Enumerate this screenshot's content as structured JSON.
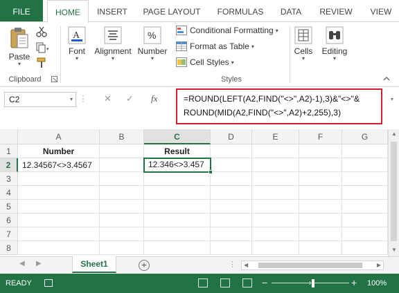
{
  "ribbon_tabs": [
    "FILE",
    "HOME",
    "INSERT",
    "PAGE LAYOUT",
    "FORMULAS",
    "DATA",
    "REVIEW",
    "VIEW"
  ],
  "clipboard": {
    "paste_label": "Paste",
    "group_label": "Clipboard"
  },
  "font_group": {
    "label": "Font"
  },
  "alignment_group": {
    "label": "Alignment"
  },
  "number_group": {
    "label": "Number"
  },
  "styles_group": {
    "conditional_formatting": "Conditional Formatting",
    "format_as_table": "Format as Table",
    "cell_styles": "Cell Styles",
    "label": "Styles"
  },
  "cells_group": {
    "label": "Cells"
  },
  "editing_group": {
    "label": "Editing"
  },
  "formula_bar": {
    "name_box": "C2",
    "fx_label": "fx",
    "formula_line1": "=ROUND(LEFT(A2,FIND(\"<>\",A2)-1),3)&\"<>\"&",
    "formula_line2": "ROUND(MID(A2,FIND(\"<>\",A2)+2,255),3)"
  },
  "columns": [
    "A",
    "B",
    "C",
    "D",
    "E",
    "F",
    "G"
  ],
  "rows": [
    "1",
    "2",
    "3",
    "4",
    "5",
    "6",
    "7",
    "8"
  ],
  "cells": {
    "A1": "Number",
    "C1": "Result",
    "A2": "12.34567<>3.4567",
    "C2": "12.346<>3.457"
  },
  "sheet_tabs": {
    "active": "Sheet1"
  },
  "status_bar": {
    "ready": "READY",
    "zoom": "100%"
  },
  "colors": {
    "accent": "#217346",
    "highlight_box": "#d01f2f"
  }
}
